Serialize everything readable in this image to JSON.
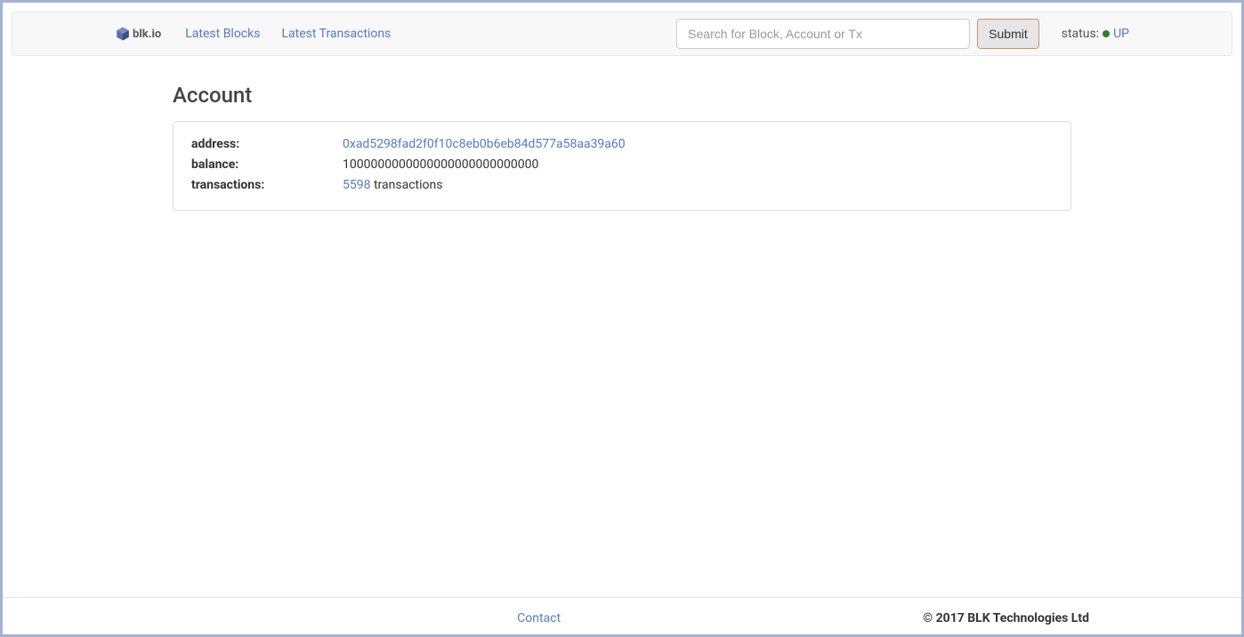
{
  "navbar": {
    "brand_text": "blk.io",
    "links": [
      {
        "label": "Latest Blocks"
      },
      {
        "label": "Latest Transactions"
      }
    ],
    "search": {
      "placeholder": "Search for Block, Account or Tx",
      "submit_label": "Submit"
    },
    "status": {
      "label": "status:",
      "value": "UP"
    }
  },
  "page": {
    "title": "Account"
  },
  "account": {
    "address_label": "address",
    "address_value": "0xad5298fad2f0f10c8eb0b6eb84d577a58aa39a60",
    "balance_label": "balance",
    "balance_value": "1000000000000000000000000000",
    "transactions_label": "transactions",
    "transactions_count": "5598",
    "transactions_suffix": " transactions"
  },
  "footer": {
    "contact_label": "Contact",
    "copyright": "© 2017 BLK Technologies Ltd"
  }
}
